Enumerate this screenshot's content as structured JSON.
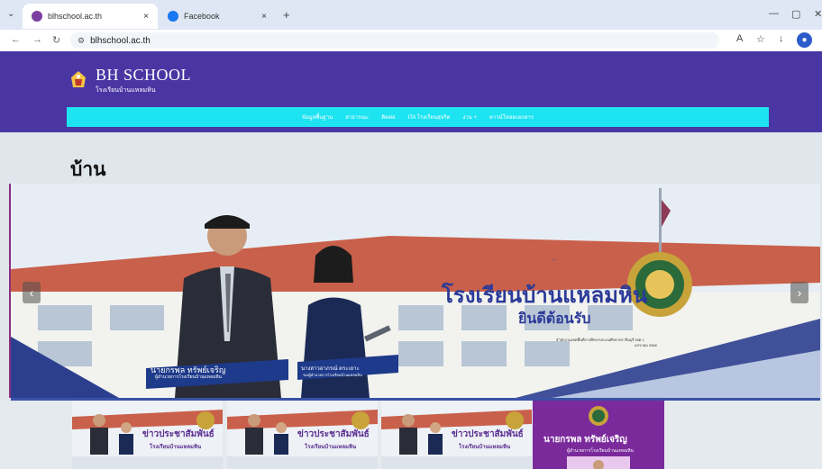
{
  "browser": {
    "tabs": [
      {
        "title": "blhschool.ac.th",
        "active": true,
        "favicon_color": "#7b3fa0"
      },
      {
        "title": "Facebook",
        "active": false,
        "favicon_color": "#1877f2"
      }
    ],
    "tab_close": "×",
    "new_tab": "+",
    "controls": {
      "minimize": "—",
      "restore": "▢",
      "close": "✕"
    },
    "url": "blhschool.ac.th"
  },
  "site": {
    "logo_title": "BH SCHOOL",
    "logo_subtitle": "โรงเรียนบ้านแหลมหิน",
    "nav": [
      "ข้อมูลพื้นฐาน",
      "สาธารณะ",
      "ติดต่อ",
      "ITA โรงเรียนสุจริต",
      "งาน +",
      "ดาวน์โหลดเอกสาร"
    ],
    "page_title": "บ้าน",
    "banner": {
      "headline": "โรงเรียนบ้านแหลมหิน",
      "subheadline": "ยินดีต้อนรับ",
      "small_top": "...",
      "affiliation": "สำนักงานเขตพื้นที่การศึกษาประถมศึกษาปราจีนบุรี เขต 1",
      "date": "มกราคม 2568",
      "person1_name": "นายกรพล ทรัพย์เจริญ",
      "person1_title": "ผู้อำนวยการโรงเรียนบ้านแหลมหิน",
      "person2_name": "นางสาวอาภรณ์ ตระเยาะ",
      "person2_title": "รองผู้อำนวยการโรงเรียนบ้านแหลมหิน",
      "arrow_left": "‹",
      "arrow_right": "›"
    },
    "thumbnails": [
      {
        "headline": "ข่าวประชาสัมพันธ์",
        "sub": "โรงเรียนบ้านแหลมหิน"
      },
      {
        "headline": "ข่าวประชาสัมพันธ์",
        "sub": "โรงเรียนบ้านแหลมหิน"
      },
      {
        "headline": "ข่าวประชาสัมพันธ์",
        "sub": "โรงเรียนบ้านแหลมหิน"
      }
    ],
    "profile_card": {
      "name": "นายกรพล ทรัพย์เจริญ",
      "role": "ผู้อำนวยการโรงเรียนบ้านแหลมหิน"
    }
  }
}
